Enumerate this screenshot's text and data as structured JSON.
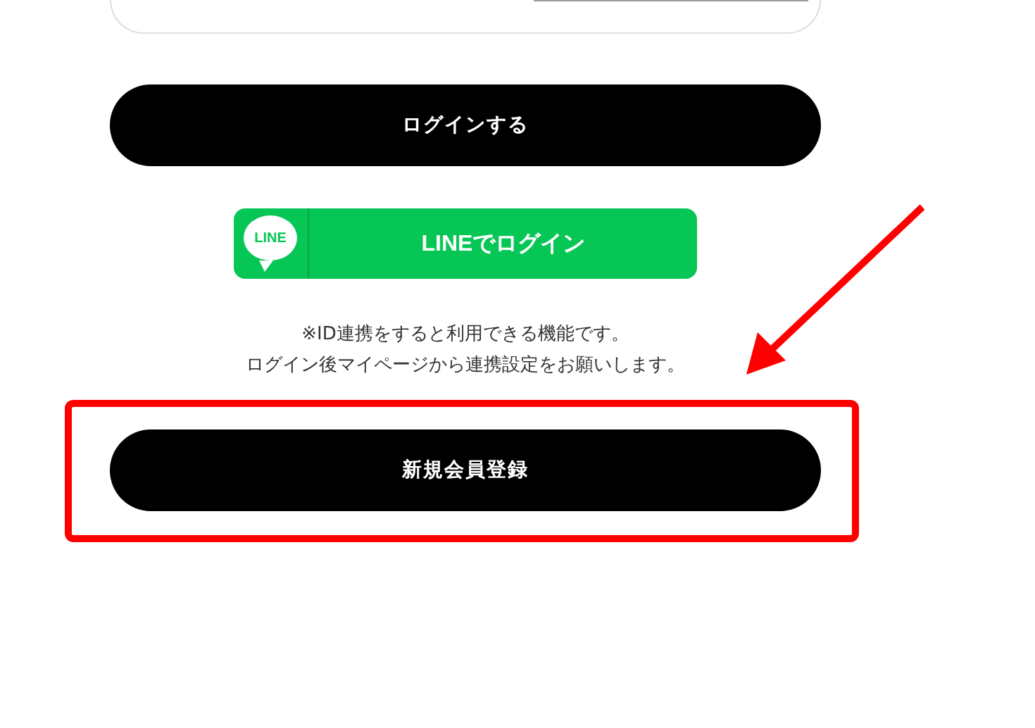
{
  "login_button": {
    "label": "ログインする"
  },
  "line_button": {
    "logo_text": "LINE",
    "label": "LINEでログイン"
  },
  "note_lines": [
    "※ID連携をすると利用できる機能です。",
    "ログイン後マイページから連携設定をお願いします。"
  ],
  "register_button": {
    "label": "新規会員登録"
  }
}
